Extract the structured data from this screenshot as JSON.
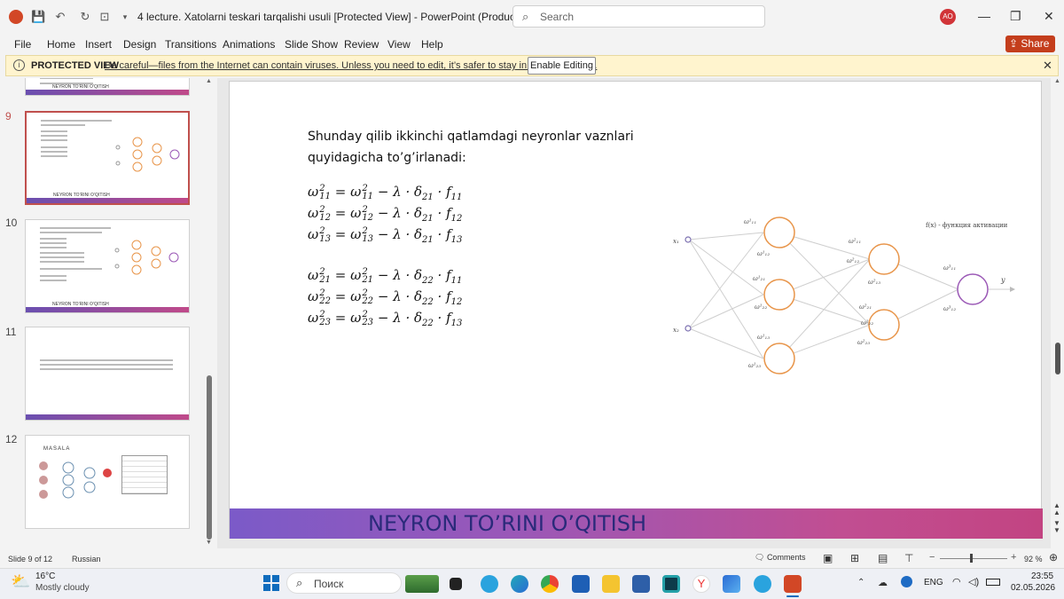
{
  "window": {
    "title": "4 lecture. Xatolarni teskari tarqalishi usuli [Protected View]  -  PowerPoint (Product Activation Fai...",
    "search_placeholder": "Search",
    "avatar_initials": "AO"
  },
  "menu": {
    "file": "File",
    "home": "Home",
    "insert": "Insert",
    "design": "Design",
    "transitions": "Transitions",
    "animations": "Animations",
    "slideshow": "Slide Show",
    "review": "Review",
    "view": "View",
    "help": "Help",
    "share": "Share"
  },
  "protected_bar": {
    "title": "PROTECTED VIEW",
    "message": "Be careful—files from the Internet can contain viruses. Unless you need to edit, it’s safer to stay in Protected View.",
    "button": "Enable Editing"
  },
  "thumbnails": [
    {
      "number": "9",
      "band_label": "NEYRON TO’RINI O’QITISH",
      "selected": true
    },
    {
      "number": "10",
      "band_label": "NEYRON TO’RINI O’QITISH",
      "selected": false
    },
    {
      "number": "11",
      "band_label": "",
      "selected": false
    },
    {
      "number": "12",
      "heading": "MASALA",
      "selected": false
    }
  ],
  "thumb_top_band_label": "NEYRON TO’RINI O’QITISH",
  "slide": {
    "text_line1": "Shunday qilib ikkinchi qatlamdagi neyronlar vaznlari",
    "text_line2": "quyidagicha to’g’irlanadi:",
    "equations_group1": [
      {
        "w": "ω",
        "sup": "2",
        "sub": "11",
        "delta": "21",
        "f": "11"
      },
      {
        "w": "ω",
        "sup": "2",
        "sub": "12",
        "delta": "21",
        "f": "12"
      },
      {
        "w": "ω",
        "sup": "2",
        "sub": "13",
        "delta": "21",
        "f": "13"
      }
    ],
    "equations_group2": [
      {
        "w": "ω",
        "sup": "2",
        "sub": "21",
        "delta": "22",
        "f": "11"
      },
      {
        "w": "ω",
        "sup": "2",
        "sub": "22",
        "delta": "22",
        "f": "12"
      },
      {
        "w": "ω",
        "sup": "2",
        "sub": "23",
        "delta": "22",
        "f": "13"
      }
    ],
    "eq_ops": {
      "eq": "=",
      "minus": "−",
      "lambda": "λ",
      "dot": "·",
      "delta": "δ",
      "f": "f"
    },
    "activation_label": "f(x) - функция активации",
    "input_labels": [
      "x₁",
      "x₂"
    ],
    "output_label": "y",
    "footer_title": "NEYRON TO’RINI O’QITISH"
  },
  "status": {
    "slide_info": "Slide 9 of 12",
    "language": "Russian",
    "comments": "Comments",
    "zoom": "92 %"
  },
  "taskbar": {
    "temperature": "16°C",
    "weather": "Mostly cloudy",
    "search_placeholder": "Поиск",
    "lang": "ENG",
    "time": "23:55",
    "date": "02.05.2026"
  },
  "colors": {
    "accent": "#c43e1c",
    "selected_thumb": "#c0504d",
    "neuron_orange": "#e8954a",
    "neuron_purple": "#9b59b6"
  }
}
